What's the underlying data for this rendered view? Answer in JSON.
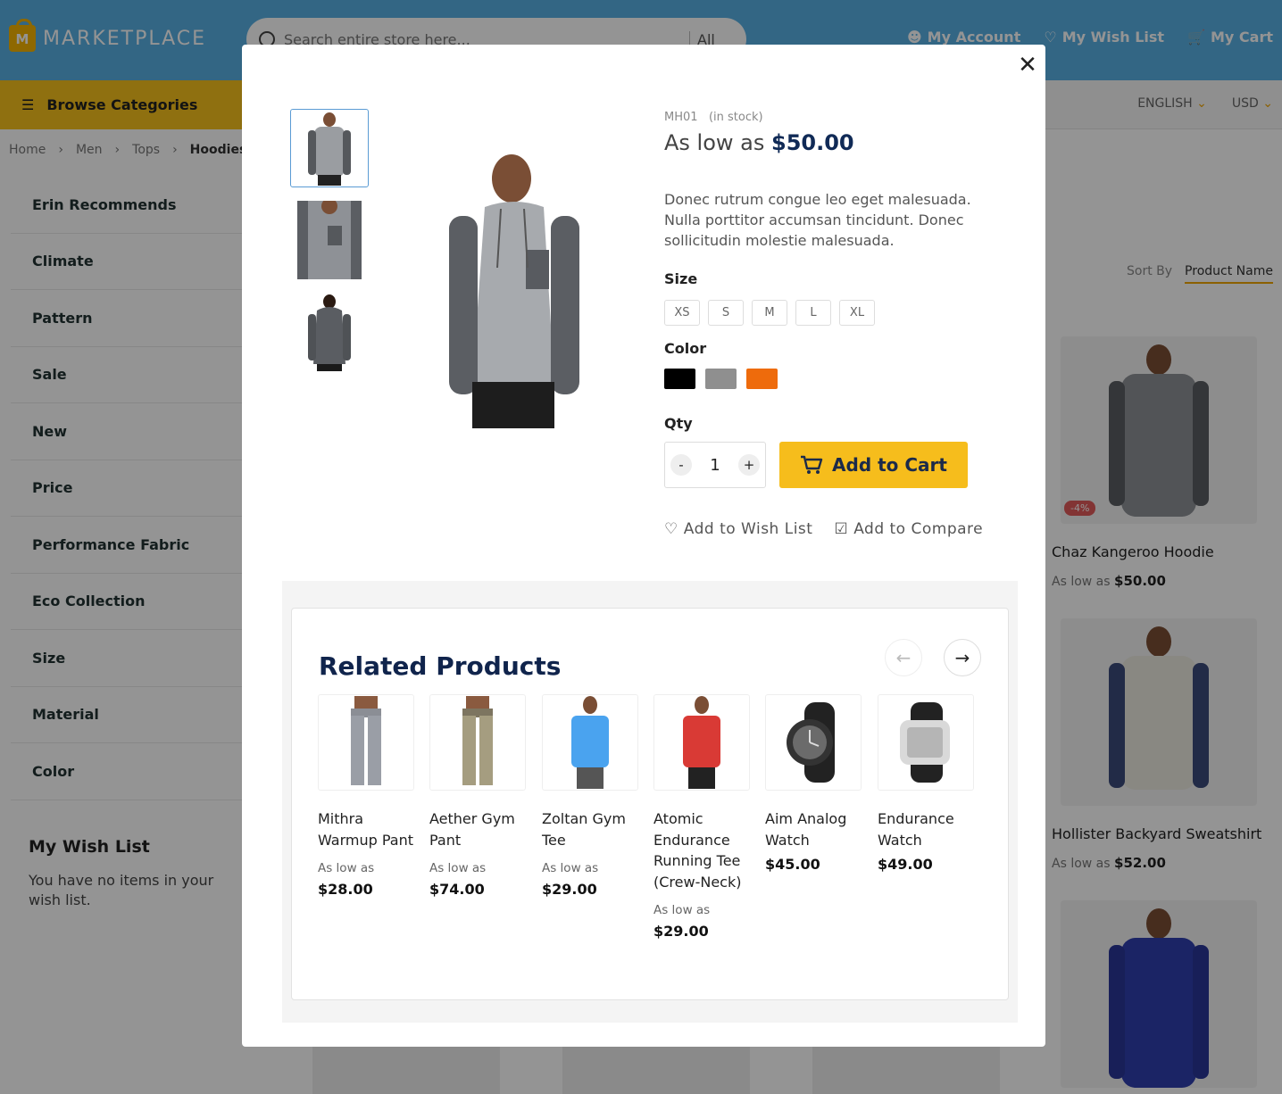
{
  "header": {
    "logo_letter": "M",
    "logo_text": "MARKETPLACE",
    "search_placeholder": "Search entire store here...",
    "search_scope": "All",
    "my_account": "My Account",
    "my_wishlist": "My Wish List",
    "my_cart": "My Cart"
  },
  "nav": {
    "browse_categories": "Browse Categories",
    "language": "ENGLISH",
    "currency": "USD"
  },
  "breadcrumbs": [
    "Home",
    "Men",
    "Tops",
    "Hoodies"
  ],
  "filters": [
    "Erin Recommends",
    "Climate",
    "Pattern",
    "Sale",
    "New",
    "Price",
    "Performance Fabric",
    "Eco Collection",
    "Size",
    "Material",
    "Color"
  ],
  "wishlist_block": {
    "title": "My Wish List",
    "empty_text": "You have no items in your wish list."
  },
  "sort": {
    "label": "Sort By",
    "value": "Product Name"
  },
  "listing": [
    {
      "name": "Chaz Kangeroo Hoodie",
      "as_low_as": "As low as",
      "price": "$50.00",
      "badge": "-4%"
    },
    {
      "name": "Hollister Backyard Sweatshirt",
      "as_low_as": "As low as",
      "price": "$52.00",
      "badge": ""
    }
  ],
  "quickview": {
    "close_glyph": "✕",
    "sku": "MH01",
    "stock": "(in stock)",
    "price_prefix": "As low as",
    "price": "$50.00",
    "description": "Donec rutrum congue leo eget malesuada. Nulla porttitor accumsan tincidunt. Donec sollicitudin molestie malesuada.",
    "size_label": "Size",
    "sizes": [
      "XS",
      "S",
      "M",
      "L",
      "XL"
    ],
    "color_label": "Color",
    "colors": [
      {
        "name": "Black",
        "hex": "#000000"
      },
      {
        "name": "Gray",
        "hex": "#8f8f8f"
      },
      {
        "name": "Orange",
        "hex": "#ee6b0c"
      }
    ],
    "qty_label": "Qty",
    "qty_value": "1",
    "qty_minus": "-",
    "qty_plus": "+",
    "add_to_cart": "Add to Cart",
    "add_to_wishlist": "Add to Wish List",
    "add_to_compare": "Add to Compare"
  },
  "related": {
    "title": "Related Products",
    "prev_arrow": "←",
    "next_arrow": "→",
    "items": [
      {
        "name": "Mithra Warmup Pant",
        "as_low_as": "As low as",
        "price": "$28.00"
      },
      {
        "name": "Aether Gym Pant",
        "as_low_as": "As low as",
        "price": "$74.00"
      },
      {
        "name": "Zoltan Gym Tee",
        "as_low_as": "As low as",
        "price": "$29.00"
      },
      {
        "name": "Atomic Endurance Running Tee (Crew-Neck)",
        "as_low_as": "As low as",
        "price": "$29.00"
      },
      {
        "name": "Aim Analog Watch",
        "as_low_as": "",
        "price": "$45.00"
      },
      {
        "name": "Endurance Watch",
        "as_low_as": "",
        "price": "$49.00"
      }
    ]
  },
  "colors": {
    "header_blue": "#58b0e4",
    "accent_yellow": "#f6bd1c",
    "navy": "#10244c"
  }
}
